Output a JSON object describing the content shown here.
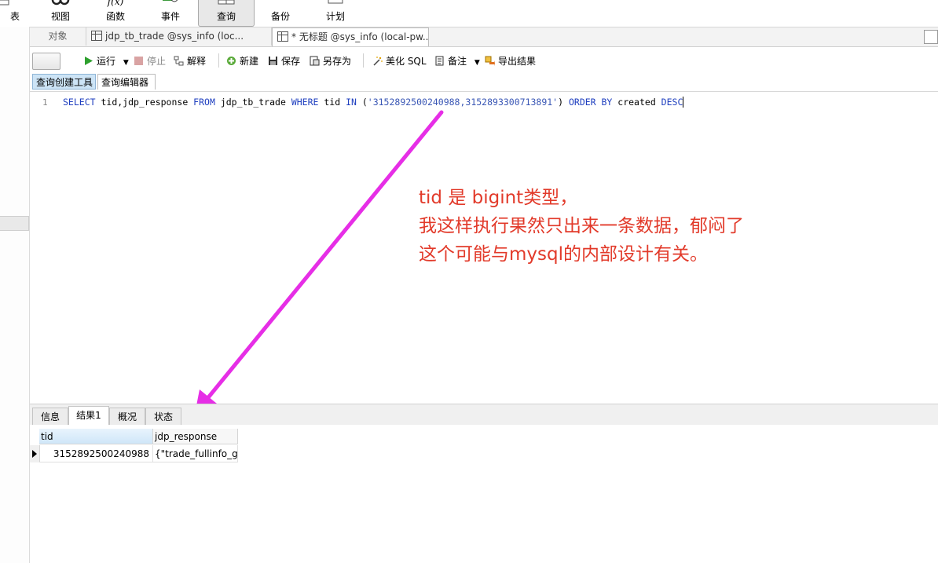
{
  "ribbon": {
    "items": [
      {
        "label": "表",
        "icon": "table-icon"
      },
      {
        "label": "视图",
        "icon": "glasses-icon"
      },
      {
        "label": "函数",
        "icon": "function-icon"
      },
      {
        "label": "事件",
        "icon": "event-clock-icon"
      },
      {
        "label": "查询",
        "icon": "query-grid-icon",
        "active": true
      },
      {
        "label": "备份",
        "icon": "backup-icon"
      },
      {
        "label": "计划",
        "icon": "schedule-icon"
      }
    ],
    "function_glyph": "f(x)"
  },
  "doc_tabs": {
    "objects_label": "对象",
    "tab1_label": "jdp_tb_trade @sys_info (loc...",
    "tab2_label": "* 无标题 @sys_info (local-pw..."
  },
  "toolbar": {
    "run_label": "运行",
    "stop_label": "停止",
    "explain_label": "解释",
    "new_label": "新建",
    "save_label": "保存",
    "save_as_label": "另存为",
    "beautify_label": "美化 SQL",
    "comment_label": "备注",
    "export_label": "导出结果"
  },
  "sub_tabs": {
    "builder_label": "查询创建工具",
    "editor_label": "查询编辑器"
  },
  "editor": {
    "line_number": "1",
    "sql": {
      "kw_select": "SELECT",
      "cols": " tid,jdp_response ",
      "kw_from": "FROM",
      "table": " jdp_tb_trade ",
      "kw_where": "WHERE",
      "col_tid": " tid ",
      "kw_in": "IN",
      "open": " (",
      "values": "'3152892500240988,3152893300713891'",
      "close": ") ",
      "kw_order": "ORDER BY",
      "col_created": " created ",
      "kw_desc": "DESC"
    }
  },
  "annotation": {
    "line1": "tid 是 bigint类型，",
    "line2": "我这样执行果然只出来一条数据，郁闷了",
    "line3": "这个可能与mysql的内部设计有关。",
    "arrow_color": "#e62ee6",
    "text_color": "#e23a2a"
  },
  "result_tabs": {
    "info_label": "信息",
    "result1_label": "结果1",
    "overview_label": "概况",
    "status_label": "状态"
  },
  "result_grid": {
    "columns": [
      "tid",
      "jdp_response"
    ],
    "rows": [
      [
        "3152892500240988",
        "{\"trade_fullinfo_get"
      ]
    ]
  }
}
